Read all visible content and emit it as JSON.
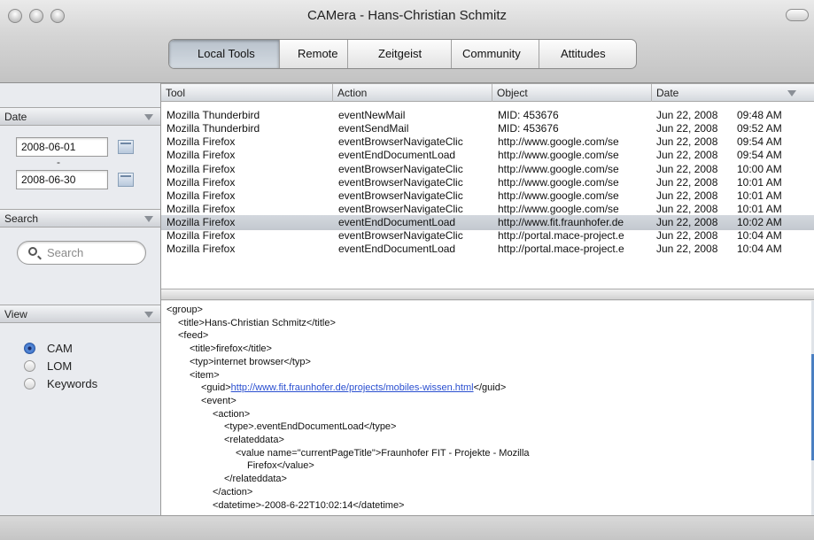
{
  "window": {
    "title": "CAMera - Hans-Christian Schmitz"
  },
  "tabs": [
    {
      "label": "Local Tools",
      "active": true
    },
    {
      "label": "Remote",
      "active": false
    },
    {
      "label": "Zeitgeist",
      "active": false
    },
    {
      "label": "Community",
      "active": false
    },
    {
      "label": "Attitudes",
      "active": false
    }
  ],
  "sidebar": {
    "date": {
      "header": "Date",
      "from": "2008-06-01",
      "separator": "-",
      "to": "2008-06-30"
    },
    "search": {
      "header": "Search",
      "placeholder": "Search"
    },
    "view": {
      "header": "View",
      "options": [
        {
          "label": "CAM",
          "selected": true
        },
        {
          "label": "LOM",
          "selected": false
        },
        {
          "label": "Keywords",
          "selected": false
        }
      ]
    }
  },
  "table": {
    "columns": [
      "Tool",
      "Action",
      "Object",
      "Date"
    ],
    "rows": [
      {
        "tool": "Mozilla Thunderbird",
        "action": "eventNewMail",
        "object": "MID: 453676",
        "date": "Jun 22, 2008",
        "time": "09:48 AM"
      },
      {
        "tool": "Mozilla Thunderbird",
        "action": "eventSendMail",
        "object": "MID: 453676",
        "date": "Jun 22, 2008",
        "time": "09:52 AM"
      },
      {
        "tool": "Mozilla Firefox",
        "action": "eventBrowserNavigateClic",
        "object": "http://www.google.com/se",
        "date": "Jun 22, 2008",
        "time": "09:54 AM"
      },
      {
        "tool": "Mozilla Firefox",
        "action": "eventEndDocumentLoad",
        "object": "http://www.google.com/se",
        "date": "Jun 22, 2008",
        "time": "09:54 AM"
      },
      {
        "tool": "Mozilla Firefox",
        "action": "eventBrowserNavigateClic",
        "object": "http://www.google.com/se",
        "date": "Jun 22, 2008",
        "time": "10:00 AM"
      },
      {
        "tool": "Mozilla Firefox",
        "action": "eventBrowserNavigateClic",
        "object": "http://www.google.com/se",
        "date": "Jun 22, 2008",
        "time": "10:01 AM"
      },
      {
        "tool": "Mozilla Firefox",
        "action": "eventBrowserNavigateClic",
        "object": "http://www.google.com/se",
        "date": "Jun 22, 2008",
        "time": "10:01 AM"
      },
      {
        "tool": "Mozilla Firefox",
        "action": "eventBrowserNavigateClic",
        "object": "http://www.google.com/se",
        "date": "Jun 22, 2008",
        "time": "10:01 AM"
      },
      {
        "tool": "Mozilla Firefox",
        "action": "eventEndDocumentLoad",
        "object": "http://www.fit.fraunhofer.de",
        "date": "Jun 22, 2008",
        "time": "10:02 AM",
        "selected": true
      },
      {
        "tool": "Mozilla Firefox",
        "action": "eventBrowserNavigateClic",
        "object": "http://portal.mace-project.e",
        "date": "Jun 22, 2008",
        "time": "10:04 AM"
      },
      {
        "tool": "Mozilla Firefox",
        "action": "eventEndDocumentLoad",
        "object": "http://portal.mace-project.e",
        "date": "Jun 22, 2008",
        "time": "10:04 AM"
      }
    ]
  },
  "xml": {
    "lines": [
      {
        "indent": 0,
        "text": "<group>"
      },
      {
        "indent": 1,
        "text": "<title>Hans-Christian Schmitz</title>"
      },
      {
        "indent": 1,
        "text": "<feed>"
      },
      {
        "indent": 2,
        "text": "<title>firefox</title>"
      },
      {
        "indent": 2,
        "text": "<typ>internet browser</typ>"
      },
      {
        "indent": 2,
        "text": "<item>"
      },
      {
        "indent": 3,
        "text": "<guid>",
        "link": "http://www.fit.fraunhofer.de/projects/mobiles-wissen.html",
        "after": "</guid>"
      },
      {
        "indent": 3,
        "text": "<event>"
      },
      {
        "indent": 4,
        "text": "<action>"
      },
      {
        "indent": 5,
        "text": "<type>.eventEndDocumentLoad</type>"
      },
      {
        "indent": 5,
        "text": "<relateddata>"
      },
      {
        "indent": 6,
        "text": "<value name=\"currentPageTitle\">Fraunhofer FIT - Projekte - Mozilla"
      },
      {
        "indent": 7,
        "text": "Firefox</value>"
      },
      {
        "indent": 5,
        "text": "</relateddata>"
      },
      {
        "indent": 4,
        "text": "</action>"
      },
      {
        "indent": 4,
        "text": "<datetime>-2008-6-22T10:02:14</datetime>"
      }
    ]
  },
  "colors": {
    "accent": "#2c63c2",
    "link": "#2a4fd0",
    "selected_row": "#c9ced5"
  }
}
